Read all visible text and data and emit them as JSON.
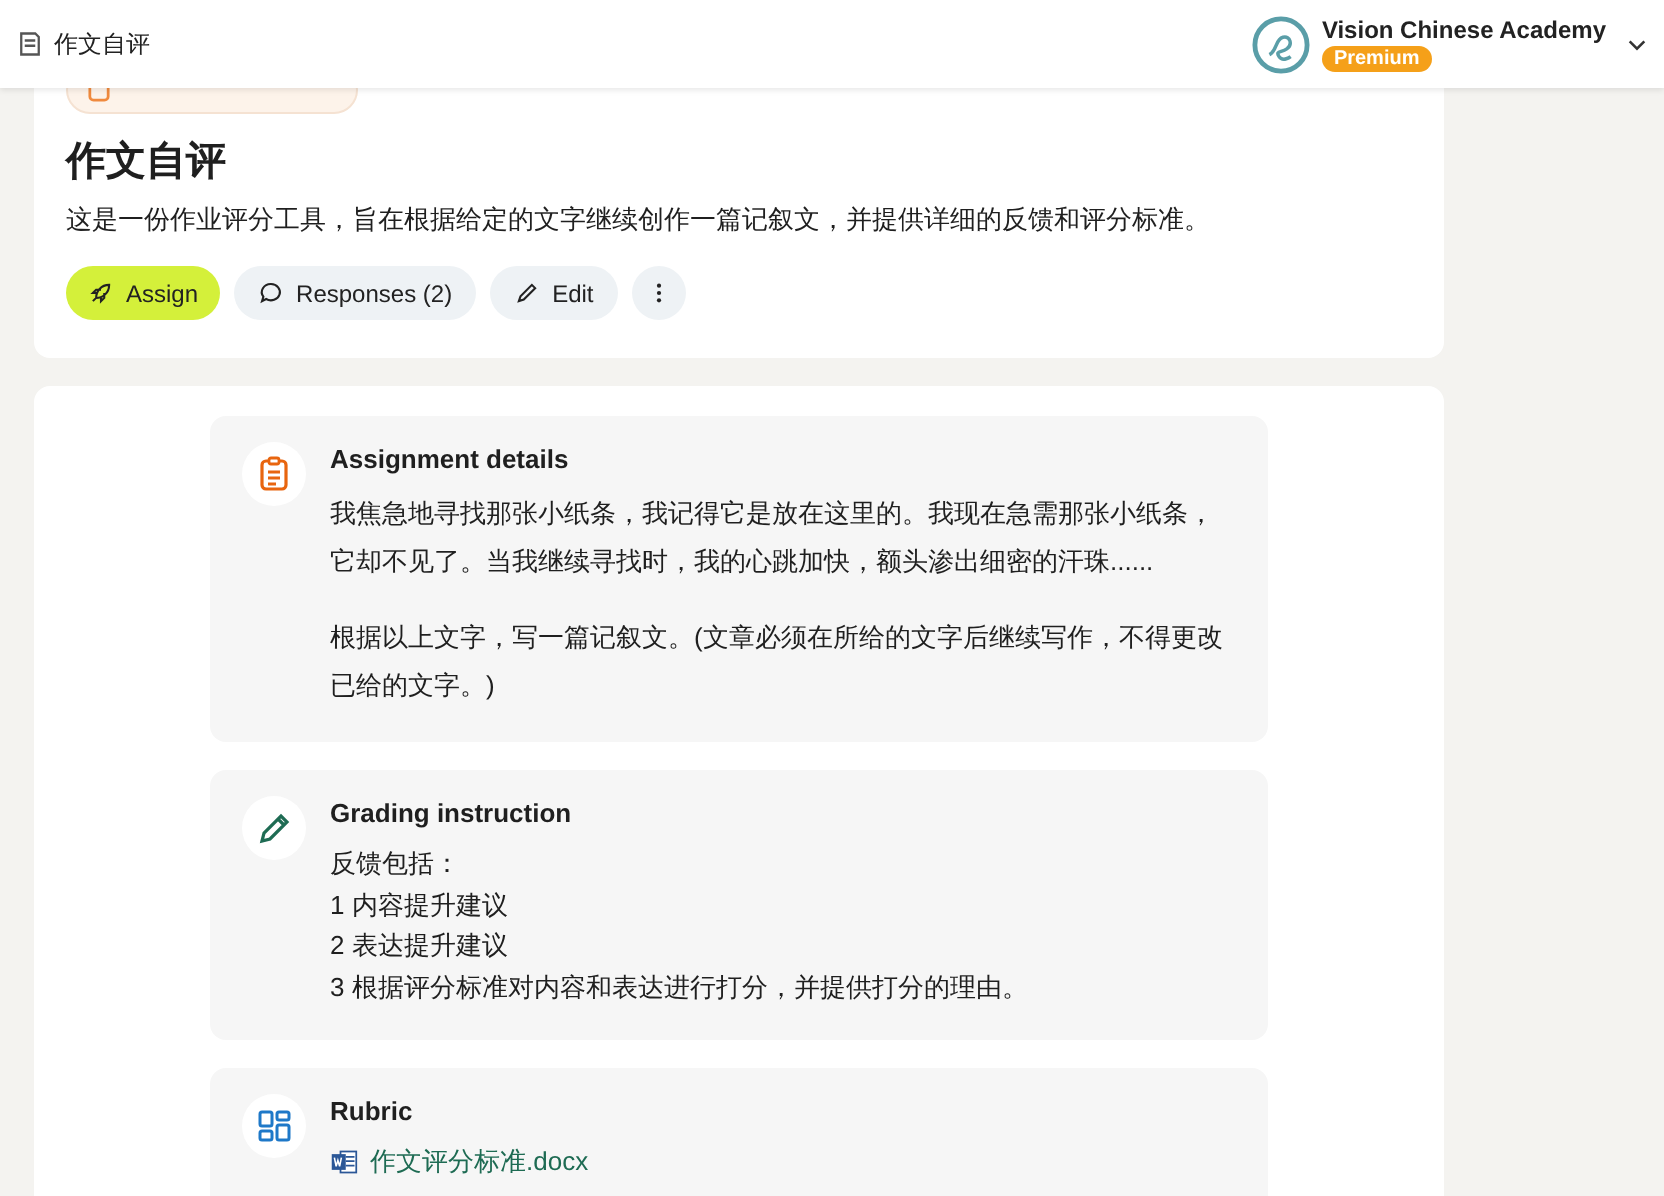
{
  "header": {
    "breadcrumb": "作文自评",
    "account": {
      "name": "Vision Chinese Academy",
      "plan": "Premium"
    }
  },
  "assignment": {
    "title": "作文自评",
    "description": "这是一份作业评分工具，旨在根据给定的文字继续创作一篇记叙文，并提供详细的反馈和评分标准。",
    "actions": [
      {
        "kind": "assign",
        "label": "Assign"
      },
      {
        "kind": "responses",
        "label": "Responses (2)"
      },
      {
        "kind": "edit",
        "label": "Edit"
      },
      {
        "kind": "more"
      }
    ]
  },
  "sections": [
    {
      "kind": "details",
      "title": "Assignment details",
      "paragraphs": [
        "我焦急地寻找那张小纸条，我记得它是放在这里的。我现在急需那张小纸条，它却不见了。当我继续寻找时，我的心跳加快，额头渗出细密的汗珠......",
        "根据以上文字，写一篇记叙文。(文章必须在所给的文字后继续写作，不得更改已给的文字。)"
      ]
    },
    {
      "kind": "grading",
      "title": "Grading instruction",
      "lines": [
        "反馈包括：",
        "1 内容提升建议",
        "2 表达提升建议",
        "3 根据评分标准对内容和表达进行打分，并提供打分的理由。"
      ]
    },
    {
      "kind": "rubric",
      "title": "Rubric",
      "file": "作文评分标准.docx"
    }
  ]
}
